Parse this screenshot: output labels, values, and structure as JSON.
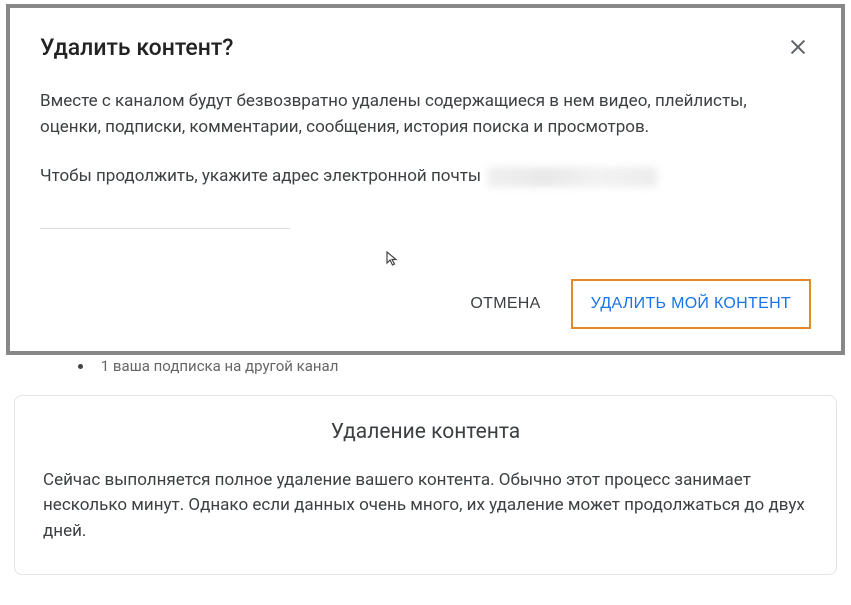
{
  "dialog": {
    "title": "Удалить контент?",
    "body1": "Вместе с каналом будут безвозвратно удалены содержащиеся в нем видео, плейлисты, оценки, подписки, комментарии, сообщения, история поиска и просмотров.",
    "body2": "Чтобы продолжить, укажите адрес электронной почты",
    "actions": {
      "cancel": "ОТМЕНА",
      "delete": "УДАЛИТЬ МОЙ КОНТЕНТ"
    }
  },
  "obscured_row": "1 ваша подписка на другой канал",
  "info": {
    "title": "Удаление контента",
    "body": "Сейчас выполняется полное удаление вашего контента. Обычно этот процесс занимает несколько минут. Однако если данных очень много, их удаление может продолжаться до двух дней."
  }
}
